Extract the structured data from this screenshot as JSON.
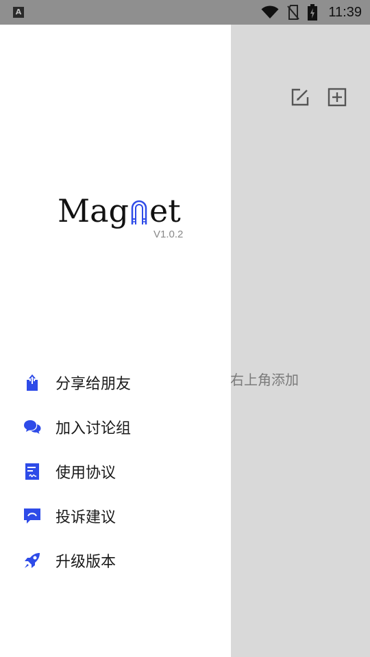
{
  "status_bar": {
    "left_icon_text": "A",
    "time": "11:39",
    "icons": [
      "wifi-icon",
      "no-sim-icon",
      "battery-charging-icon"
    ]
  },
  "main": {
    "empty_hint": "右上角添加",
    "top_actions": [
      "edit-icon",
      "add-icon"
    ]
  },
  "drawer": {
    "logo": {
      "text_before": "Mag",
      "text_after": "et",
      "version": "V1.0.2"
    },
    "menu": [
      {
        "label": "分享给朋友",
        "icon": "share-icon"
      },
      {
        "label": "加入讨论组",
        "icon": "chat-icon"
      },
      {
        "label": "使用协议",
        "icon": "document-icon"
      },
      {
        "label": "投诉建议",
        "icon": "feedback-icon"
      },
      {
        "label": "升级版本",
        "icon": "rocket-icon"
      }
    ],
    "accent_color": "#2e4be8"
  }
}
